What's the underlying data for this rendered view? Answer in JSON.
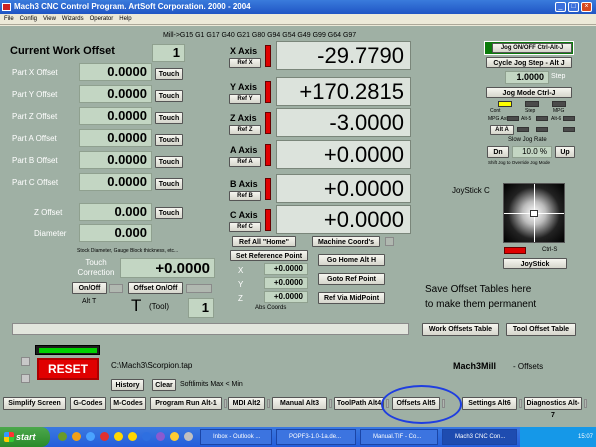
{
  "window": {
    "title": "Mach3 CNC Control Program. ArtSoft Corporation. 2000 - 2004",
    "minimize": "_",
    "maximize": "□",
    "close": "×"
  },
  "menu": [
    "File",
    "Config",
    "View",
    "Wizards",
    "Operator",
    "Help"
  ],
  "gcodes": "Mill->G15  G1 G17 G40 G21 G80 G94 G54 G49 G99 G64 G97",
  "offsets": {
    "title": "Current Work Offset",
    "work_offset": "1",
    "rows": [
      {
        "label": "Part X Offset",
        "value": "0.0000",
        "button": "Touch"
      },
      {
        "label": "Part Y Offset",
        "value": "0.0000",
        "button": "Touch"
      },
      {
        "label": "Part Z Offset",
        "value": "0.0000",
        "button": "Touch"
      },
      {
        "label": "Part A Offset",
        "value": "0.0000",
        "button": "Touch"
      },
      {
        "label": "Part B Offset",
        "value": "0.0000",
        "button": "Touch"
      },
      {
        "label": "Part C Offset",
        "value": "0.0000",
        "button": "Touch"
      }
    ],
    "z_offset_label": "Z Offset",
    "z_offset": "0.000",
    "z_touch": "Touch",
    "diameter_label": "Diameter",
    "diameter": "0.000",
    "stock_note": "Stock Diameter, Gauge Block thickness, etc...",
    "touch_correction_label": "Touch Correction",
    "touch_correction": "+0.0000",
    "on_off": "On/Off",
    "offset_on_off": "Offset On/Off",
    "alt_t": "Alt T",
    "tool_label": "T",
    "tool_paren": "(Tool)",
    "tool_value": "1"
  },
  "axes": [
    {
      "name": "X Axis",
      "ref": "Ref X",
      "value": "-29.7790"
    },
    {
      "name": "Y Axis",
      "ref": "Ref Y",
      "value": "+170.2815"
    },
    {
      "name": "Z Axis",
      "ref": "Ref Z",
      "value": "-3.0000"
    },
    {
      "name": "A Axis",
      "ref": "Ref A",
      "value": "+0.0000"
    },
    {
      "name": "B Axis",
      "ref": "Ref B",
      "value": "+0.0000"
    },
    {
      "name": "C Axis",
      "ref": "Ref C",
      "value": "+0.0000"
    }
  ],
  "ref_all": "Ref All \"Home\"",
  "machine_coords": "Machine Coord's",
  "set_reference": {
    "title": "Set Reference Point",
    "x_label": "X",
    "x": "+0.0000",
    "y_label": "Y",
    "y": "+0.0000",
    "z_label": "Z",
    "z": "+0.0000",
    "caption": "Abs Coords"
  },
  "go_home": "Go Home Alt H",
  "goto_ref": "Goto Ref Point",
  "ref_mid": "Ref Via MidPoint",
  "jog": {
    "jog_onoff": "Jog ON/OFF Ctrl-Alt-J",
    "cycle_step": "Cycle Jog Step - Alt J",
    "step_value": "1.0000",
    "step_label": "Step",
    "jog_mode": "Jog Mode Ctrl-J",
    "mode_labels": [
      "Cont",
      "Step",
      "MPG"
    ],
    "mpg_labels": [
      "MPG Axis",
      "Alt-5",
      "Alt-6"
    ],
    "alt_a": "Alt A",
    "slow_jog": "Slow Jog Rate",
    "dn": "Dn",
    "rate": "10.0 %",
    "up": "Up",
    "shift_note": "Shift Jog to Override Jog Mode"
  },
  "joystick": {
    "label": "JoyStick C",
    "ctrl": "Ctrl-S",
    "button": "JoyStick"
  },
  "save_note_1": "Save Offset Tables here",
  "save_note_2": "to make them permanent",
  "work_offsets_table": "Work Offsets Table",
  "tool_offset_table": "Tool Offset Table",
  "file_path": "C:\\Mach3\\Scorpion.tap",
  "app_name": "Mach3Mill",
  "screen_name": "- Offsets",
  "reset": "RESET",
  "history": "History",
  "clear": "Clear",
  "softlimits": "Softlimits Max < Min",
  "tabs": [
    "Simplify Screen",
    "G-Codes",
    "M-Codes",
    "Program Run Alt-1",
    "MDI Alt2",
    "Manual Alt3",
    "ToolPath Alt4",
    "Offsets Alt5",
    "Settings Alt6",
    "Diagnostics Alt-7"
  ],
  "taskbar": {
    "start": "start",
    "tasks": [
      "Inbox - Outlook ...",
      "POPF3-1.0-1a.de...",
      "Manual.TIF - Co...",
      "Mach3 CNC Con..."
    ],
    "clock": "15:07"
  },
  "colors": {
    "panel": "#9fb0a4",
    "dro_bg": "#c3d6c3",
    "reset": "#e00000",
    "highlight": "#1f3ee0"
  }
}
